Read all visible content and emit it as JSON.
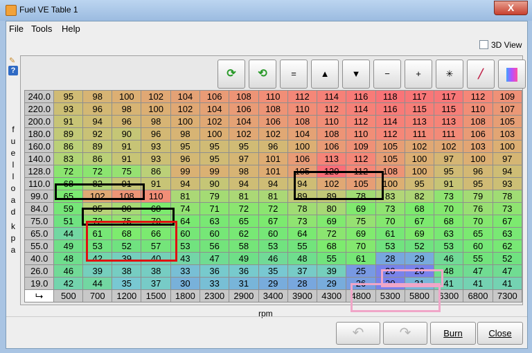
{
  "window": {
    "title": "Fuel VE Table 1",
    "close_glyph": "X"
  },
  "menu": {
    "file": "File",
    "tools": "Tools",
    "help": "Help"
  },
  "view3d": {
    "label": "3D View"
  },
  "toolbar": [
    {
      "name": "increase-button",
      "glyph": "⟳"
    },
    {
      "name": "decrease-button",
      "glyph": "⟲"
    },
    {
      "name": "set-equal-button",
      "glyph": "="
    },
    {
      "name": "raise-button",
      "glyph": "▲"
    },
    {
      "name": "lower-button",
      "glyph": "▼"
    },
    {
      "name": "subtract-button",
      "glyph": "−"
    },
    {
      "name": "add-button",
      "glyph": "+"
    },
    {
      "name": "multiply-button",
      "glyph": "✳"
    },
    {
      "name": "interpolate-button",
      "glyph": "╱"
    },
    {
      "name": "color-map-button",
      "glyph": ""
    }
  ],
  "y_axis": {
    "label_letters": [
      "f",
      "u",
      "e",
      "l",
      "l",
      "o",
      "a",
      "d",
      "k",
      "p",
      "a"
    ]
  },
  "x_axis": {
    "label": "rpm"
  },
  "corner_glyph": "⮡",
  "rows": [
    {
      "kpa": "240.0",
      "values": [
        95,
        98,
        100,
        102,
        104,
        106,
        108,
        110,
        112,
        114,
        116,
        118,
        117,
        117,
        112,
        109
      ]
    },
    {
      "kpa": "220.0",
      "values": [
        93,
        96,
        98,
        100,
        102,
        104,
        106,
        108,
        110,
        112,
        114,
        116,
        115,
        115,
        110,
        107
      ]
    },
    {
      "kpa": "200.0",
      "values": [
        91,
        94,
        96,
        98,
        100,
        102,
        104,
        106,
        108,
        110,
        112,
        114,
        113,
        113,
        108,
        105
      ]
    },
    {
      "kpa": "180.0",
      "values": [
        89,
        92,
        90,
        96,
        98,
        100,
        102,
        102,
        104,
        108,
        110,
        112,
        111,
        111,
        106,
        103
      ]
    },
    {
      "kpa": "160.0",
      "values": [
        86,
        89,
        91,
        93,
        95,
        95,
        95,
        96,
        100,
        106,
        109,
        105,
        102,
        102,
        103,
        100
      ]
    },
    {
      "kpa": "140.0",
      "values": [
        83,
        86,
        91,
        93,
        96,
        95,
        97,
        101,
        106,
        113,
        112,
        105,
        100,
        97,
        100,
        97
      ]
    },
    {
      "kpa": "128.0",
      "values": [
        72,
        72,
        75,
        86,
        99,
        99,
        98,
        101,
        105,
        120,
        112,
        108,
        100,
        95,
        96,
        94
      ]
    },
    {
      "kpa": "110.0",
      "values": [
        68,
        82,
        91,
        91,
        94,
        90,
        94,
        94,
        94,
        102,
        105,
        100,
        95,
        91,
        95,
        93
      ]
    },
    {
      "kpa": "99.0",
      "values": [
        65,
        102,
        108,
        110,
        81,
        79,
        81,
        81,
        89,
        89,
        78,
        83,
        82,
        73,
        79,
        78
      ]
    },
    {
      "kpa": "84.0",
      "values": [
        59,
        85,
        80,
        68,
        74,
        71,
        72,
        72,
        78,
        80,
        69,
        73,
        68,
        70,
        76,
        73
      ]
    },
    {
      "kpa": "75.0",
      "values": [
        51,
        72,
        75,
        70,
        64,
        63,
        65,
        67,
        73,
        69,
        75,
        70,
        67,
        68,
        70,
        67
      ]
    },
    {
      "kpa": "65.0",
      "values": [
        44,
        61,
        68,
        66,
        60,
        60,
        62,
        60,
        64,
        72,
        69,
        61,
        69,
        63,
        65,
        63
      ]
    },
    {
      "kpa": "55.0",
      "values": [
        49,
        53,
        52,
        57,
        53,
        56,
        58,
        53,
        55,
        68,
        70,
        53,
        52,
        53,
        60,
        62
      ]
    },
    {
      "kpa": "40.0",
      "values": [
        48,
        42,
        39,
        40,
        43,
        47,
        49,
        46,
        48,
        55,
        61,
        28,
        29,
        46,
        55,
        52
      ]
    },
    {
      "kpa": "26.0",
      "values": [
        46,
        39,
        38,
        38,
        33,
        36,
        36,
        35,
        37,
        39,
        25,
        20,
        20,
        48,
        47,
        47
      ]
    },
    {
      "kpa": "19.0",
      "values": [
        42,
        44,
        35,
        37,
        30,
        33,
        31,
        29,
        28,
        29,
        26,
        20,
        31,
        41,
        41,
        41
      ]
    }
  ],
  "rpm": [
    "500",
    "700",
    "1200",
    "1500",
    "1800",
    "2300",
    "2900",
    "3400",
    "3900",
    "4300",
    "4800",
    "5300",
    "5800",
    "6300",
    "6800",
    "7300"
  ],
  "buttons": {
    "undo_glyph": "↶",
    "redo_glyph": "↷",
    "burn": "Burn",
    "close": "Close"
  },
  "highlight_colors": {
    "black": "#000000",
    "red": "#e01010",
    "pink": "#f0a6c8"
  }
}
